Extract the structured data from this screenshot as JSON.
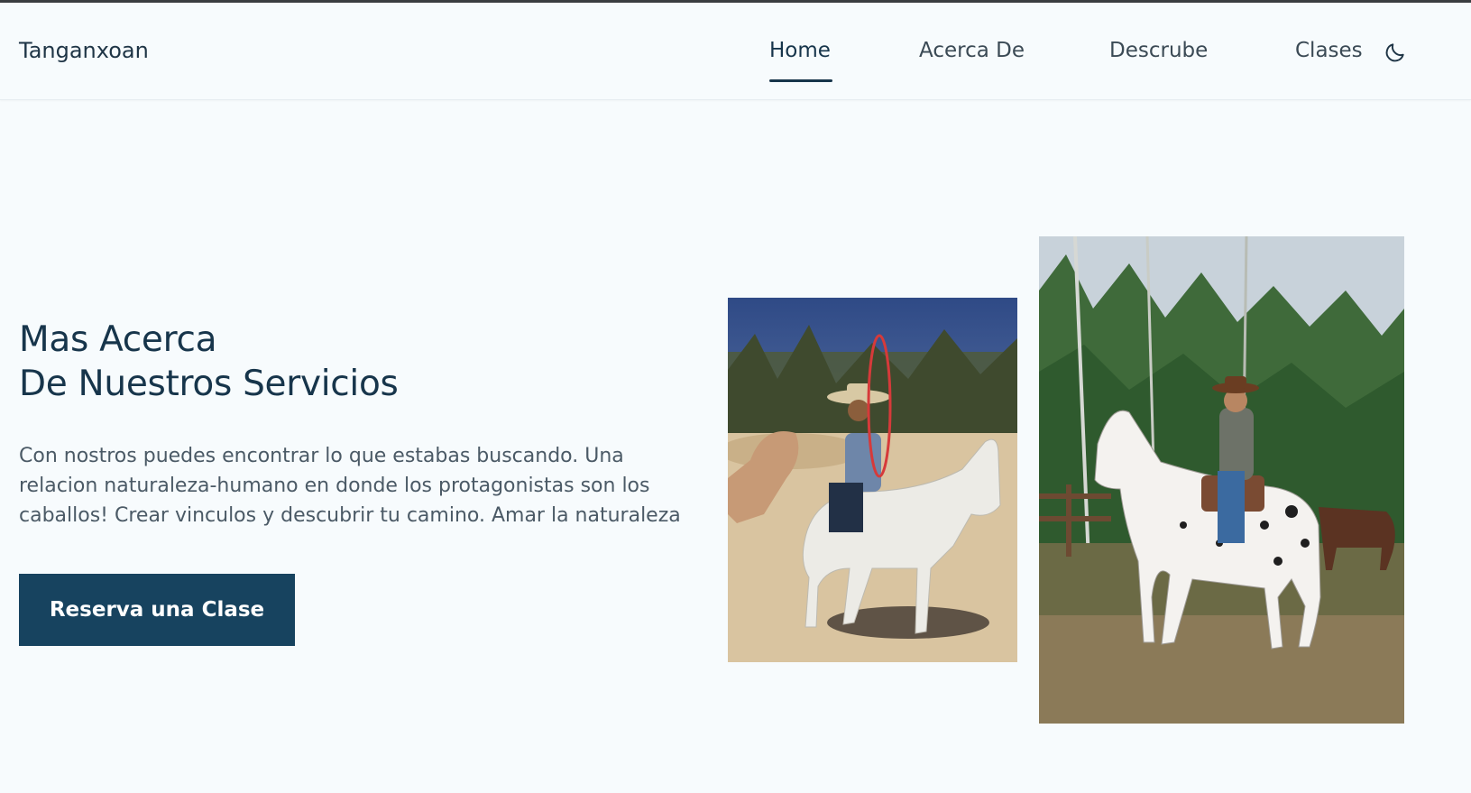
{
  "header": {
    "brand": "Tanganxoan",
    "nav": [
      {
        "label": "Home",
        "active": true
      },
      {
        "label": "Acerca De",
        "active": false
      },
      {
        "label": "Descrube",
        "active": false
      },
      {
        "label": "Clases",
        "active": false
      }
    ],
    "theme_icon": "moon-icon"
  },
  "hero": {
    "title_line1": "Mas Acerca",
    "title_line2": "De Nuestros Servicios",
    "description": "Con nostros puedes encontrar lo que estabas buscando. Una relacion naturaleza-humano en donde los protagonistas son los caballos! Crear vinculos y descubrir tu camino. Amar la naturaleza",
    "cta_label": "Reserva una Clase"
  },
  "colors": {
    "primary": "#17435f",
    "heading": "#17354b",
    "background": "#f7fbfd"
  }
}
